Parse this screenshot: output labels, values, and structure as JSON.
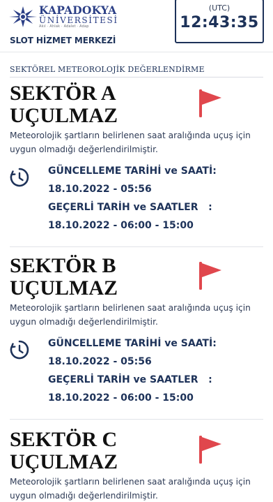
{
  "header": {
    "logo_line1": "KAPADOKYA",
    "logo_line2": "ÜNİVERSİTESİ",
    "logo_tagline": "Akıl · Ahlak · Adalet · Adap",
    "center_name": "SLOT HİZMET MERKEZİ",
    "clock_label": "(UTC)",
    "clock_time": "12:43:35"
  },
  "section_title": "SEKTÖREL METEOROLOJİK DEĞERLENDİRME",
  "sectors": [
    {
      "name": "SEKTÖR A",
      "status": "UÇULMAZ",
      "description": "Meteorolojik şartların belirlenen saat aralığında uçuş için uygun olmadığı değerlendirilmiştir.",
      "update_label": "GÜNCELLEME TARİHİ ve SAATİ:",
      "update_value": "18.10.2022 - 05:56",
      "valid_label": "GEÇERLİ TARİH ve SAATLER   :",
      "valid_value": "18.10.2022 - 06:00 - 15:00"
    },
    {
      "name": "SEKTÖR B",
      "status": "UÇULMAZ",
      "description": "Meteorolojik şartların belirlenen saat aralığında uçuş için uygun olmadığı değerlendirilmiştir.",
      "update_label": "GÜNCELLEME TARİHİ ve SAATİ:",
      "update_value": "18.10.2022 - 05:56",
      "valid_label": "GEÇERLİ TARİH ve SAATLER   :",
      "valid_value": "18.10.2022 - 06:00 - 15:00"
    },
    {
      "name": "SEKTÖR C",
      "status": "UÇULMAZ",
      "description": "Meteorolojik şartların belirlenen saat aralığında uçuş için uygun olmadığı değerlendirilmiştir."
    }
  ],
  "colors": {
    "navy": "#1d3259",
    "flag_red": "#e0474d",
    "logo_blue": "#2b3f86"
  },
  "icons": {
    "status_flag": "red-flag-icon",
    "update_time": "clock-history-icon"
  }
}
